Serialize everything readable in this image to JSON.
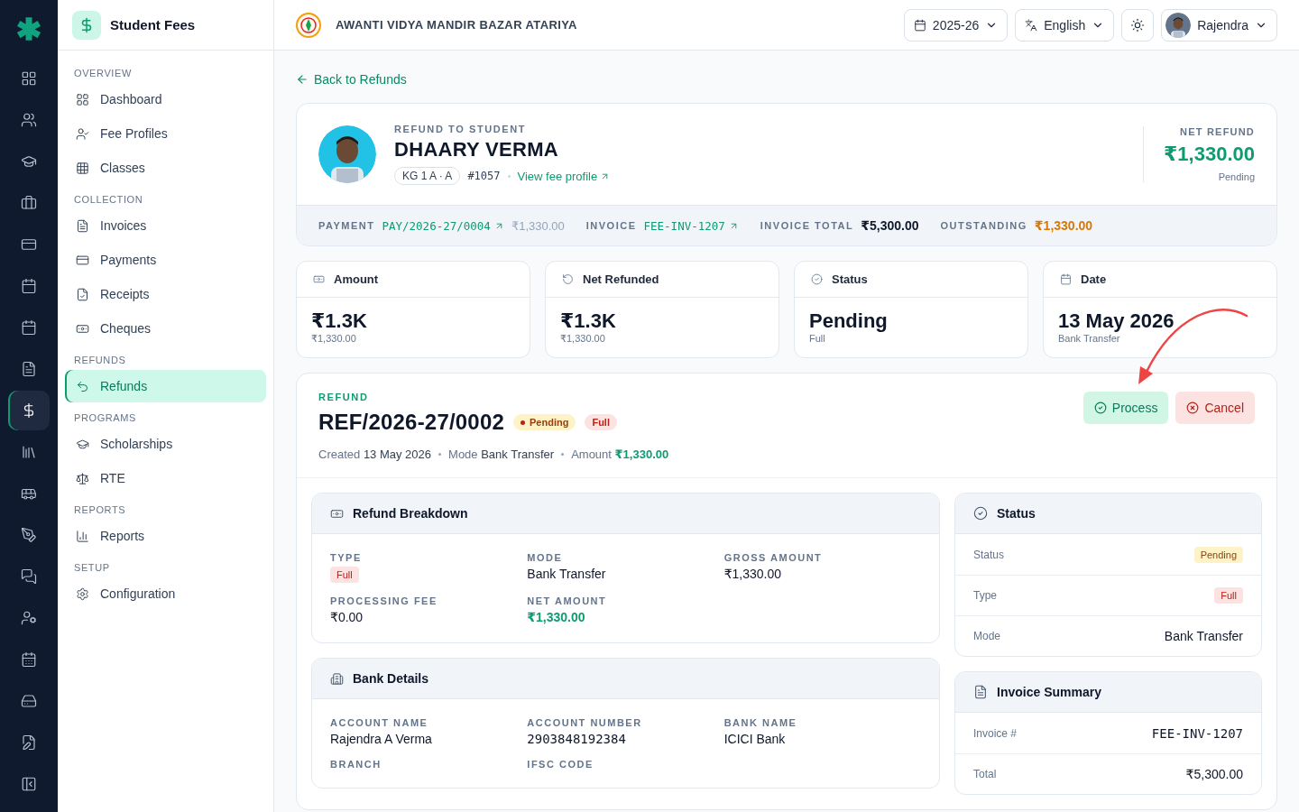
{
  "app_rail": [
    {
      "selected": false
    },
    {
      "selected": false
    },
    {
      "selected": false
    },
    {
      "selected": false
    },
    {
      "selected": false
    },
    {
      "selected": false
    },
    {
      "selected": false
    },
    {
      "selected": false
    },
    {
      "selected": true
    },
    {
      "selected": false
    },
    {
      "selected": false
    },
    {
      "selected": false
    },
    {
      "selected": false
    },
    {
      "selected": false
    },
    {
      "selected": false
    },
    {
      "selected": false
    },
    {
      "selected": false
    }
  ],
  "sidebar": {
    "title": "Student Fees",
    "sections": [
      {
        "heading": "OVERVIEW",
        "items": [
          {
            "label": "Dashboard",
            "selected": false
          },
          {
            "label": "Fee Profiles",
            "selected": false
          },
          {
            "label": "Classes",
            "selected": false
          }
        ]
      },
      {
        "heading": "COLLECTION",
        "items": [
          {
            "label": "Invoices",
            "selected": false
          },
          {
            "label": "Payments",
            "selected": false
          },
          {
            "label": "Receipts",
            "selected": false
          },
          {
            "label": "Cheques",
            "selected": false
          }
        ]
      },
      {
        "heading": "REFUNDS",
        "items": [
          {
            "label": "Refunds",
            "selected": true
          }
        ]
      },
      {
        "heading": "PROGRAMS",
        "items": [
          {
            "label": "Scholarships",
            "selected": false
          },
          {
            "label": "RTE",
            "selected": false
          }
        ]
      },
      {
        "heading": "REPORTS",
        "items": [
          {
            "label": "Reports",
            "selected": false
          }
        ]
      },
      {
        "heading": "SETUP",
        "items": [
          {
            "label": "Configuration",
            "selected": false
          }
        ]
      }
    ]
  },
  "header": {
    "school": "AWANTI VIDYA MANDIR BAZAR ATARIYA",
    "year": "2025-26",
    "language": "English",
    "user": "Rajendra"
  },
  "back_link": "Back to Refunds",
  "student": {
    "eyebrow": "REFUND TO STUDENT",
    "name": "DHAARY VERMA",
    "class_tag": "KG 1 A · A",
    "number": "#1057",
    "profile_link": "View fee profile",
    "net_label": "NET REFUND",
    "net_amount": "₹1,330.00",
    "net_status": "Pending"
  },
  "summary_bar": [
    {
      "label": "PAYMENT",
      "value": "PAY/2026-27/0004",
      "kind": "link",
      "extra": "₹1,330.00"
    },
    {
      "label": "INVOICE",
      "value": "FEE-INV-1207",
      "kind": "link"
    },
    {
      "label": "INVOICE TOTAL",
      "value": "₹5,300.00",
      "kind": "strong"
    },
    {
      "label": "OUTSTANDING",
      "value": "₹1,330.00",
      "kind": "warning"
    }
  ],
  "stats": [
    {
      "title": "Amount",
      "value": "₹1.3K",
      "sub": "₹1,330.00"
    },
    {
      "title": "Net Refunded",
      "value": "₹1.3K",
      "sub": "₹1,330.00"
    },
    {
      "title": "Status",
      "value": "Pending",
      "sub": "Full"
    },
    {
      "title": "Date",
      "value": "13 May 2026",
      "sub": "Bank Transfer"
    }
  ],
  "refund": {
    "eyebrow": "REFUND",
    "number": "REF/2026-27/0002",
    "badges": [
      {
        "label": "Pending",
        "kind": "pending"
      },
      {
        "label": "Full",
        "kind": "full"
      }
    ],
    "meta": [
      {
        "label": "Created",
        "value": "13 May 2026",
        "kind": "text"
      },
      {
        "label": "Mode",
        "value": "Bank Transfer",
        "kind": "text"
      },
      {
        "label": "Amount",
        "value": "₹1,330.00",
        "kind": "amount"
      }
    ],
    "actions": [
      {
        "label": "Process",
        "kind": "process"
      },
      {
        "label": "Cancel",
        "kind": "cancel"
      }
    ]
  },
  "breakdown": {
    "title": "Refund Breakdown",
    "fields": [
      {
        "label": "TYPE",
        "value": "Full",
        "kind": "badge"
      },
      {
        "label": "MODE",
        "value": "Bank Transfer",
        "kind": "text"
      },
      {
        "label": "GROSS AMOUNT",
        "value": "₹1,330.00",
        "kind": "text"
      },
      {
        "label": "PROCESSING FEE",
        "value": "₹0.00",
        "kind": "text"
      },
      {
        "label": "NET AMOUNT",
        "value": "₹1,330.00",
        "kind": "amount"
      }
    ]
  },
  "bank": {
    "title": "Bank Details",
    "fields": [
      {
        "label": "ACCOUNT NAME",
        "value": "Rajendra A Verma",
        "kind": "text"
      },
      {
        "label": "ACCOUNT NUMBER",
        "value": "2903848192384",
        "kind": "mono"
      },
      {
        "label": "BANK NAME",
        "value": "ICICI Bank",
        "kind": "text"
      },
      {
        "label": "BRANCH"
      },
      {
        "label": "IFSC CODE"
      }
    ]
  },
  "status_panel": {
    "title": "Status",
    "rows": [
      {
        "label": "Status",
        "value": "Pending",
        "kind": "pending"
      },
      {
        "label": "Type",
        "value": "Full",
        "kind": "full"
      },
      {
        "label": "Mode",
        "value": "Bank Transfer",
        "kind": "text"
      }
    ]
  },
  "invoice_summary": {
    "title": "Invoice Summary",
    "rows": [
      {
        "label": "Invoice #",
        "value": "FEE-INV-1207",
        "kind": "mono"
      },
      {
        "label": "Total",
        "value": "₹5,300.00",
        "kind": "text"
      }
    ]
  }
}
